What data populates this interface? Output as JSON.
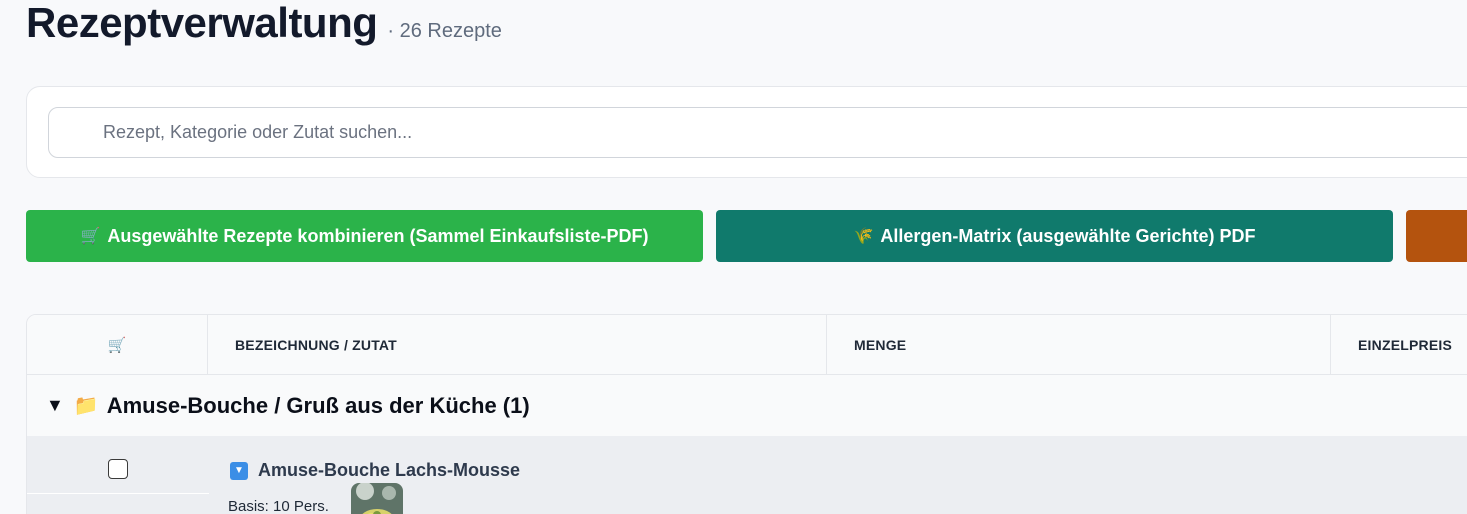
{
  "header": {
    "title": "Rezeptverwaltung",
    "count": "· 26 Rezepte"
  },
  "search": {
    "placeholder": "Rezept, Kategorie oder Zutat suchen...",
    "value": ""
  },
  "actions": {
    "combine": {
      "icon": "🛒",
      "label": "Ausgewählte Rezepte kombinieren (Sammel Einkaufsliste-PDF)",
      "color": "#2bb34a"
    },
    "allergen": {
      "icon": "🌾",
      "label": "Allergen-Matrix (ausgewählte Gerichte) PDF",
      "color": "#107a6c"
    },
    "third": {
      "label": "",
      "color": "#b4530e"
    }
  },
  "table": {
    "columns": {
      "cart_icon": "🛒",
      "name": "BEZEICHNUNG / ZUTAT",
      "qty": "MENGE",
      "price": "EINZELPREIS"
    },
    "groups": [
      {
        "caret": "▼",
        "folder_icon": "📁",
        "label": "Amuse-Bouche / Gruß aus der Küche (1)",
        "recipes": [
          {
            "expand_icon": "▼",
            "name": "Amuse-Bouche Lachs-Mousse",
            "base": "Basis: 10 Pers.",
            "checked": false
          }
        ]
      }
    ]
  }
}
